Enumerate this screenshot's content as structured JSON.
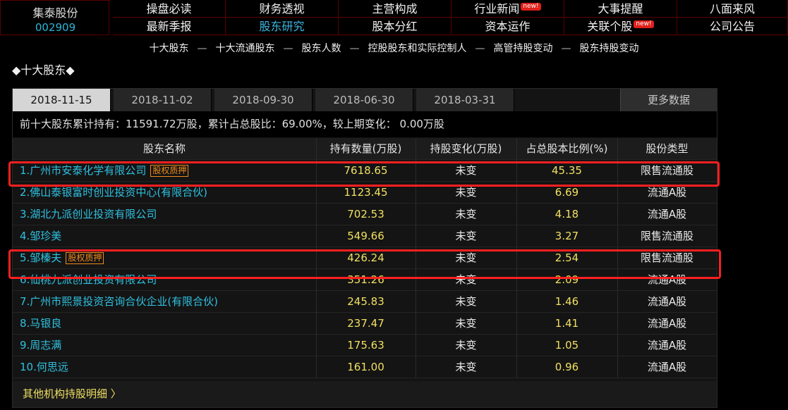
{
  "stock": {
    "name": "集泰股份",
    "code": "002909"
  },
  "nav": {
    "row1": [
      "操盘必读",
      "财务透视",
      "主营构成",
      "行业新闻",
      "大事提醒",
      "八面来风"
    ],
    "row2": [
      "最新季报",
      "股东研究",
      "股本分红",
      "资本运作",
      "关联个股",
      "公司公告"
    ],
    "new_badge": "new!"
  },
  "subnav": [
    "十大股东",
    "十大流通股东",
    "股东人数",
    "控股股东和实际控制人",
    "高管持股变动",
    "股东持股变动"
  ],
  "subnav_sep": "—",
  "section_title": "◆十大股东◆",
  "tabs": [
    "2018-11-15",
    "2018-11-02",
    "2018-09-30",
    "2018-06-30",
    "2018-03-31"
  ],
  "more_label": "更多数据",
  "summary": "前十大股东累计持有：11591.72万股，累计占总股比：69.00%，较上期变化：  0.00万股",
  "table": {
    "headers": [
      "股东名称",
      "持有数量(万股)",
      "持股变化(万股)",
      "占总股本比例(%)",
      "股份类型"
    ],
    "pledge_label": "股权质押",
    "rows": [
      {
        "name": "1.广州市安泰化学有限公司",
        "pledge": true,
        "qty": "7618.65",
        "chg": "未变",
        "pct": "45.35",
        "type": "限售流通股"
      },
      {
        "name": "2.佛山泰银富时创业投资中心(有限合伙)",
        "pledge": false,
        "qty": "1123.45",
        "chg": "未变",
        "pct": "6.69",
        "type": "流通A股"
      },
      {
        "name": "3.湖北九派创业投资有限公司",
        "pledge": false,
        "qty": "702.53",
        "chg": "未变",
        "pct": "4.18",
        "type": "流通A股"
      },
      {
        "name": "4.邹珍美",
        "pledge": false,
        "qty": "549.66",
        "chg": "未变",
        "pct": "3.27",
        "type": "限售流通股"
      },
      {
        "name": "5.邹榛夫",
        "pledge": true,
        "qty": "426.24",
        "chg": "未变",
        "pct": "2.54",
        "type": "限售流通股"
      },
      {
        "name": "6.仙桃九派创业投资有限公司",
        "pledge": false,
        "qty": "351.26",
        "chg": "未变",
        "pct": "2.09",
        "type": "流通A股"
      },
      {
        "name": "7.广州市熙景投资咨询合伙企业(有限合伙)",
        "pledge": false,
        "qty": "245.83",
        "chg": "未变",
        "pct": "1.46",
        "type": "流通A股"
      },
      {
        "name": "8.马银良",
        "pledge": false,
        "qty": "237.47",
        "chg": "未变",
        "pct": "1.41",
        "type": "流通A股"
      },
      {
        "name": "9.周志满",
        "pledge": false,
        "qty": "175.63",
        "chg": "未变",
        "pct": "1.05",
        "type": "流通A股"
      },
      {
        "name": "10.何思远",
        "pledge": false,
        "qty": "161.00",
        "chg": "未变",
        "pct": "0.96",
        "type": "流通A股"
      }
    ]
  },
  "footer_link": "其他机构持股明细 〉",
  "colors": {
    "highlight": "#ff2020",
    "pledge": "#f08a1c",
    "cyan": "#2ec0df",
    "yellow": "#f0e062"
  }
}
